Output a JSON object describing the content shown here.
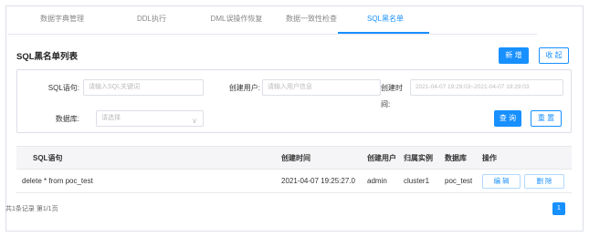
{
  "tabs": [
    {
      "label": "数据字典管理"
    },
    {
      "label": "DDL执行"
    },
    {
      "label": "DML误操作恢复"
    },
    {
      "label": "数据一致性检查"
    },
    {
      "label": "SQL黑名单"
    }
  ],
  "list_title": "SQL黑名单列表",
  "toolbar": {
    "add_label": "新 增",
    "collapse_label": "收 起"
  },
  "search": {
    "sql_label": "SQL语句:",
    "sql_placeholder": "请输入SQL关键词",
    "user_label": "创建用户:",
    "user_placeholder": "请输入用户信息",
    "time_label_1": "创建时",
    "time_label_2": "间:",
    "time_range": "2021-04-07 19:29:03~2021-04-07 19:29:03",
    "db_label": "数据库:",
    "db_placeholder": "请选择",
    "query_label": "查 询",
    "reset_label": "重 置"
  },
  "table": {
    "headers": [
      "SQL语句",
      "创建时间",
      "创建用户",
      "归属实例",
      "数据库",
      "操作"
    ],
    "rows": [
      {
        "sql": "delete * from poc_test",
        "time": "2021-04-07 19:25:27.0",
        "user": "admin",
        "instance": "cluster1",
        "db": "poc_test",
        "edit": "编 辑",
        "delete": "删 除"
      }
    ]
  },
  "pagination": {
    "summary": "共1条记录 第1/1页",
    "current_page": "1"
  }
}
